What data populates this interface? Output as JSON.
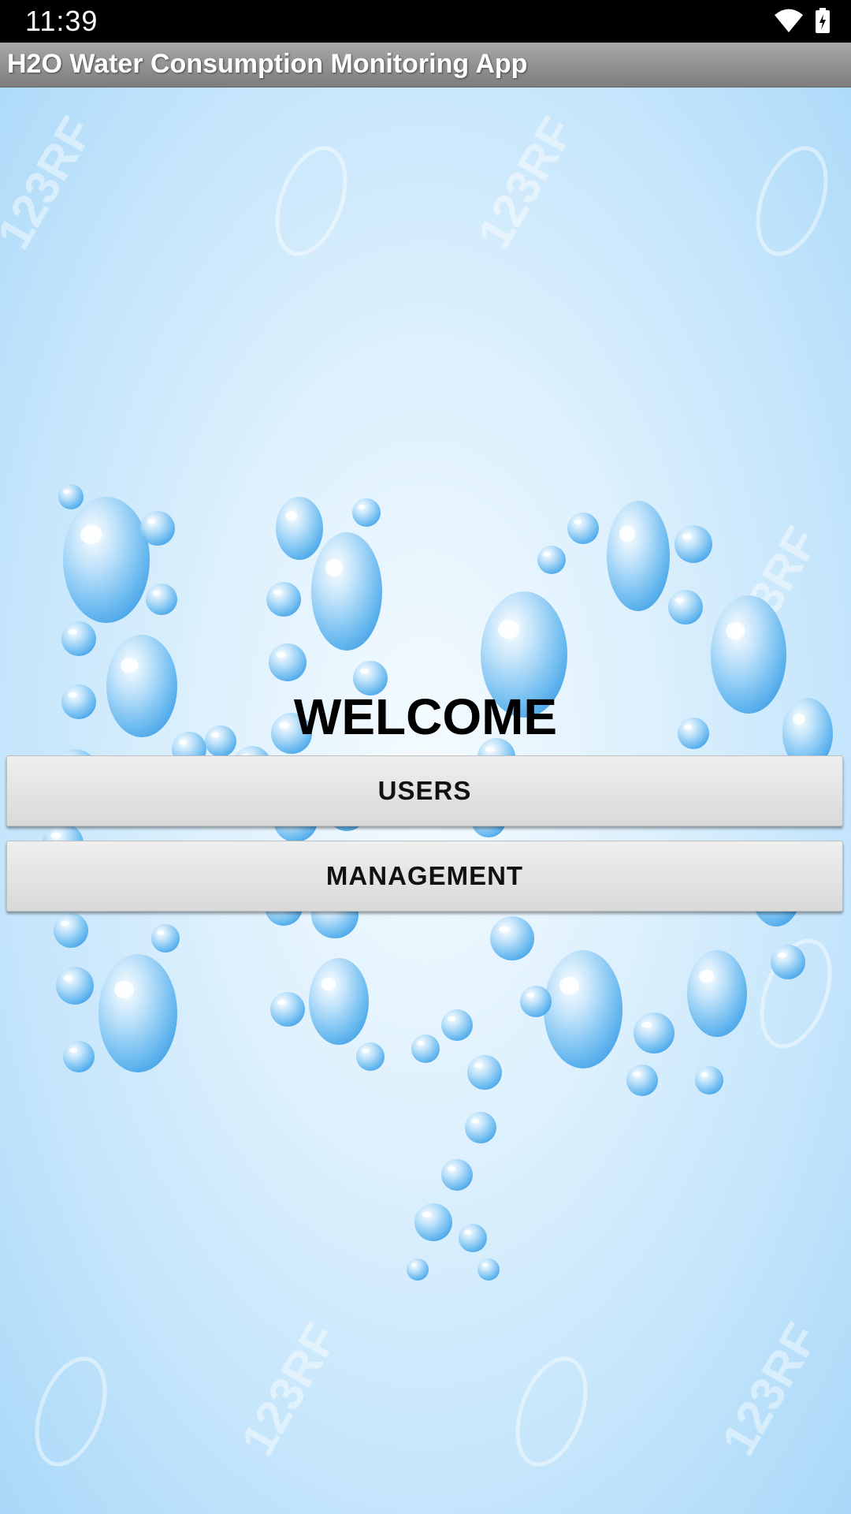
{
  "status_bar": {
    "time": "11:39",
    "icons": [
      "wifi-icon",
      "battery-icon"
    ]
  },
  "app_bar": {
    "title": "H2O Water Consumption Monitoring App"
  },
  "main": {
    "welcome_text": "WELCOME",
    "users_button_label": "USERS",
    "management_button_label": "MANAGEMENT"
  },
  "background": {
    "artwork": "H2O letters made of water bubbles",
    "watermark": "123RF"
  },
  "colors": {
    "status_bar": "#000000",
    "app_bar": "#8f8f8f",
    "background_light": "#f4fbff",
    "background_dark": "#a9d8f8",
    "bubble": "#5fb3ee",
    "button": "#e3e3e3"
  }
}
